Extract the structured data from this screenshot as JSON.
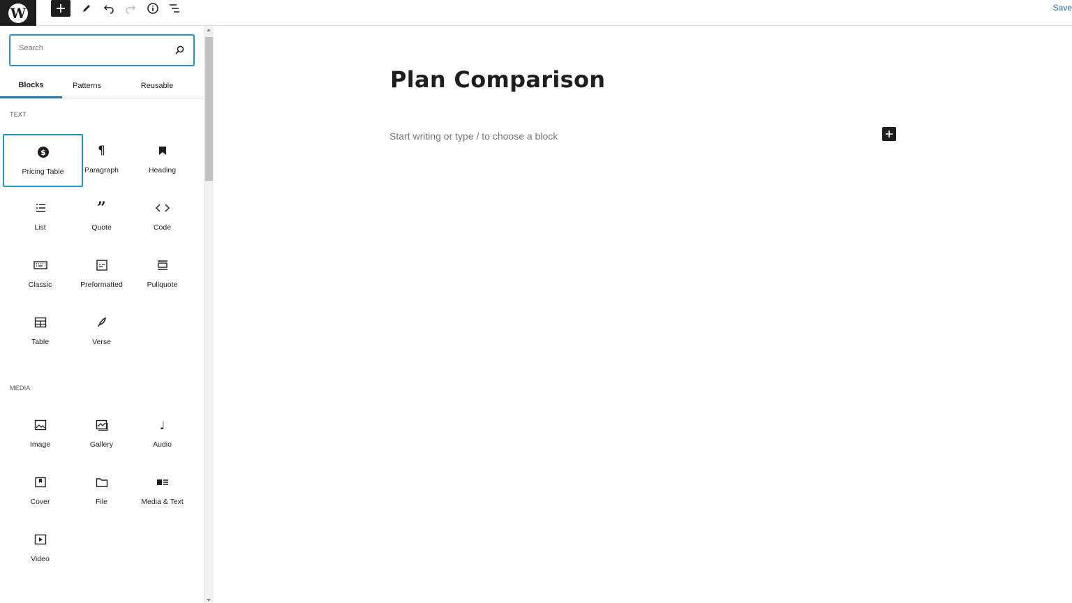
{
  "toolbar": {
    "add_block_label": "Add block",
    "save_label": "Save",
    "icons": [
      "wordpress-icon",
      "plus-icon",
      "pencil-icon",
      "undo-icon",
      "redo-icon",
      "info-icon",
      "list-view-icon"
    ]
  },
  "inserter": {
    "search_placeholder": "Search",
    "tabs": [
      {
        "label": "Blocks",
        "active": true
      },
      {
        "label": "Patterns",
        "active": false
      },
      {
        "label": "Reusable",
        "active": false
      }
    ],
    "categories": [
      {
        "title": "TEXT",
        "blocks": [
          {
            "label": "Pricing Table",
            "icon": "dollar-icon",
            "selected": true
          },
          {
            "label": "Paragraph",
            "icon": "paragraph-icon"
          },
          {
            "label": "Heading",
            "icon": "bookmark-icon"
          },
          {
            "label": "List",
            "icon": "list-icon"
          },
          {
            "label": "Quote",
            "icon": "quote-icon"
          },
          {
            "label": "Code",
            "icon": "code-icon"
          },
          {
            "label": "Classic",
            "icon": "keyboard-icon"
          },
          {
            "label": "Preformatted",
            "icon": "preformatted-icon"
          },
          {
            "label": "Pullquote",
            "icon": "pullquote-icon"
          },
          {
            "label": "Table",
            "icon": "table-icon"
          },
          {
            "label": "Verse",
            "icon": "feather-icon"
          }
        ]
      },
      {
        "title": "MEDIA",
        "blocks": [
          {
            "label": "Image",
            "icon": "image-icon"
          },
          {
            "label": "Gallery",
            "icon": "gallery-icon"
          },
          {
            "label": "Audio",
            "icon": "music-note-icon"
          },
          {
            "label": "Cover",
            "icon": "cover-icon"
          },
          {
            "label": "File",
            "icon": "folder-icon"
          },
          {
            "label": "Media & Text",
            "icon": "media-text-icon"
          },
          {
            "label": "Video",
            "icon": "video-icon"
          }
        ]
      }
    ]
  },
  "editor": {
    "title": "Plan Comparison",
    "placeholder": "Start writing or type / to choose a block"
  },
  "colors": {
    "accent": "#2271b1",
    "selection": "#2196c4",
    "dark": "#1e1e1e"
  }
}
